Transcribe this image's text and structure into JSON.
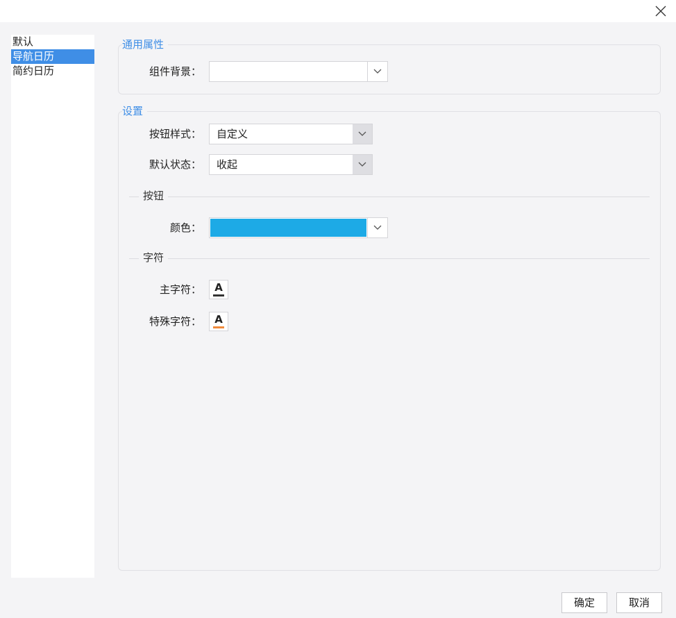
{
  "sidebar": {
    "items": [
      {
        "label": "默认",
        "selected": false
      },
      {
        "label": "导航日历",
        "selected": true
      },
      {
        "label": "简约日历",
        "selected": false
      }
    ]
  },
  "general": {
    "legend": "通用属性",
    "background_label": "组件背景：",
    "background_value": ""
  },
  "settings": {
    "legend": "设置",
    "button_style_label": "按钮样式：",
    "button_style_value": "自定义",
    "default_state_label": "默认状态：",
    "default_state_value": "收起",
    "button_section": "按钮",
    "color_label": "颜色：",
    "color_value": "#1daae6",
    "char_section": "字符",
    "main_char_label": "主字符：",
    "main_char_glyph": "A",
    "main_char_color": "#333333",
    "special_char_label": "特殊字符：",
    "special_char_glyph": "A",
    "special_char_color": "#f08a3c"
  },
  "icons": {
    "close": "close-icon",
    "dropdown": "chevron-down-icon"
  },
  "footer": {
    "ok_label": "确定",
    "cancel_label": "取消"
  },
  "colors": {
    "accent": "#3f8ee6",
    "background": "#f4f4f6"
  }
}
